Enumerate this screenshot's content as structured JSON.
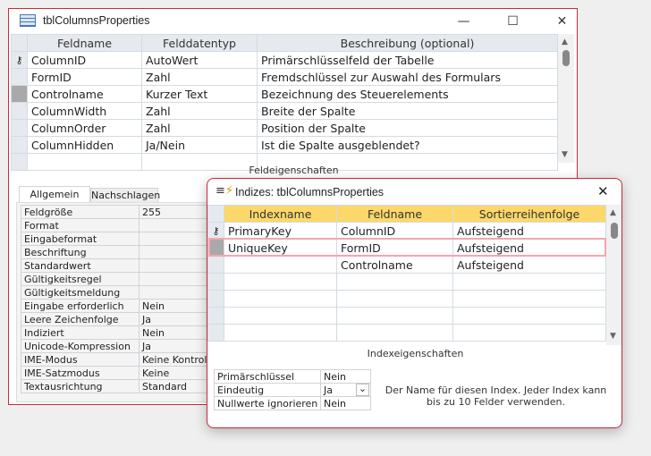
{
  "main_window": {
    "title": "tblColumnsProperties",
    "controls": {
      "minimize": "—",
      "maximize": "☐",
      "close": "✕"
    },
    "columns": [
      "Feldname",
      "Felddatentyp",
      "Beschreibung (optional)"
    ],
    "rows": [
      [
        "ColumnID",
        "AutoWert",
        "Primärschlüsselfeld der Tabelle"
      ],
      [
        "FormID",
        "Zahl",
        "Fremdschlüssel zur Auswahl des Formulars"
      ],
      [
        "Controlname",
        "Kurzer Text",
        "Bezeichnung des Steuerelements"
      ],
      [
        "ColumnWidth",
        "Zahl",
        "Breite der Spalte"
      ],
      [
        "ColumnOrder",
        "Zahl",
        "Position der Spalte"
      ],
      [
        "ColumnHidden",
        "Ja/Nein",
        "Ist die Spalte ausgeblendet?"
      ]
    ],
    "section_label": "Feldeigenschaften",
    "tabs": [
      "Allgemein",
      "Nachschlagen"
    ],
    "properties": [
      [
        "Feldgröße",
        "255"
      ],
      [
        "Format",
        ""
      ],
      [
        "Eingabeformat",
        ""
      ],
      [
        "Beschriftung",
        ""
      ],
      [
        "Standardwert",
        ""
      ],
      [
        "Gültigkeitsregel",
        ""
      ],
      [
        "Gültigkeitsmeldung",
        ""
      ],
      [
        "Eingabe erforderlich",
        "Nein"
      ],
      [
        "Leere Zeichenfolge",
        "Ja"
      ],
      [
        "Indiziert",
        "Nein"
      ],
      [
        "Unicode-Kompression",
        "Ja"
      ],
      [
        "IME-Modus",
        "Keine Kontrolle"
      ],
      [
        "IME-Satzmodus",
        "Keine"
      ],
      [
        "Textausrichtung",
        "Standard"
      ]
    ]
  },
  "index_dialog": {
    "title": "Indizes: tblColumnsProperties",
    "close": "✕",
    "columns": [
      "Indexname",
      "Feldname",
      "Sortierreihenfolge"
    ],
    "rows": [
      [
        "PrimaryKey",
        "ColumnID",
        "Aufsteigend"
      ],
      [
        "UniqueKey",
        "FormID",
        "Aufsteigend"
      ],
      [
        "",
        "Controlname",
        "Aufsteigend"
      ]
    ],
    "section_label": "Indexeigenschaften",
    "properties": [
      [
        "Primärschlüssel",
        "Nein"
      ],
      [
        "Eindeutig",
        "Ja"
      ],
      [
        "Nullwerte ignorieren",
        "Nein"
      ]
    ],
    "help_text": "Der Name für diesen Index. Jeder Index kann bis zu 10 Felder verwenden."
  },
  "colors": {
    "accent": "#c42b3c",
    "header_yellow": "#fbd869",
    "highlight": "#f4a7ad"
  }
}
